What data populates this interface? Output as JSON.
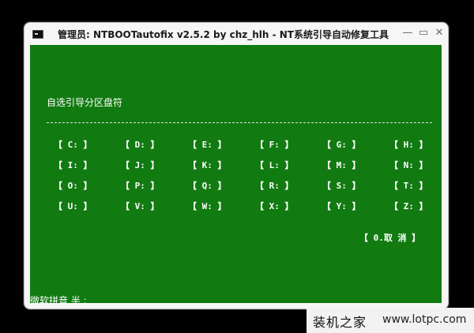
{
  "window": {
    "title": "管理员:  NTBOOTautofix v2.5.2 by chz_hlh - NT系统引导自动修复工具",
    "minimize_glyph": "—",
    "maximize_glyph": "▭",
    "close_glyph": "✕",
    "icon": "console-icon"
  },
  "console": {
    "background_color": "#117a11",
    "heading": "自选引导分区盘符",
    "drive_rows": [
      [
        "【 C: 】",
        "【 D: 】",
        "【 E: 】",
        "【 F: 】",
        "【 G: 】",
        "【 H: 】"
      ],
      [
        "【 I: 】",
        "【 J: 】",
        "【 K: 】",
        "【 L: 】",
        "【 M: 】",
        "【 N: 】"
      ],
      [
        "【 O: 】",
        "【 P: 】",
        "【 Q: 】",
        "【 R: 】",
        "【 S: 】",
        "【 T: 】"
      ],
      [
        "【 U: 】",
        "【 V: 】",
        "【 W: 】",
        "【 X: 】",
        "【 Y: 】",
        "【 Z: 】"
      ]
    ],
    "cancel_option": "【 0.取  消 】",
    "ime_status": "微软拼音 半 :"
  },
  "watermark": {
    "brand": "装机之家",
    "url": "www.lotpc.com"
  }
}
